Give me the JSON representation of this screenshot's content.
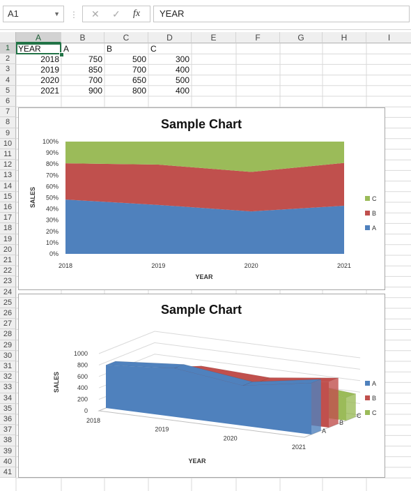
{
  "formula_bar": {
    "name_box": "A1",
    "cancel_icon": "✕",
    "enter_icon": "✓",
    "fx_icon": "fx",
    "formula_value": "YEAR"
  },
  "columns": [
    "A",
    "B",
    "C",
    "D",
    "E",
    "F",
    "G",
    "H",
    "I"
  ],
  "rows": [
    "1",
    "2",
    "3",
    "4",
    "5",
    "6",
    "7",
    "8",
    "9",
    "10",
    "11",
    "12",
    "13",
    "14",
    "15",
    "16",
    "17",
    "18",
    "19",
    "20",
    "21",
    "22",
    "23",
    "24",
    "25",
    "26",
    "27",
    "28",
    "29",
    "30",
    "31",
    "32",
    "33",
    "34",
    "35",
    "36",
    "37",
    "38",
    "39",
    "40",
    "41"
  ],
  "sheet": {
    "headers": [
      "YEAR",
      "A",
      "B",
      "C"
    ],
    "data_rows": [
      [
        "2018",
        "750",
        "500",
        "300"
      ],
      [
        "2019",
        "850",
        "700",
        "400"
      ],
      [
        "2020",
        "700",
        "650",
        "500"
      ],
      [
        "2021",
        "900",
        "800",
        "400"
      ]
    ]
  },
  "chart_data": [
    {
      "type": "area",
      "subtype": "100% stacked",
      "title": "Sample Chart",
      "xlabel": "YEAR",
      "ylabel": "SALES",
      "x": [
        "2018",
        "2019",
        "2020",
        "2021"
      ],
      "y_ticks": [
        "0%",
        "10%",
        "20%",
        "30%",
        "40%",
        "50%",
        "60%",
        "70%",
        "80%",
        "90%",
        "100%"
      ],
      "ylim": [
        0,
        1
      ],
      "series": [
        {
          "name": "A",
          "values": [
            750,
            850,
            700,
            900
          ],
          "color": "#4f81bd"
        },
        {
          "name": "B",
          "values": [
            500,
            700,
            650,
            800
          ],
          "color": "#c0504d"
        },
        {
          "name": "C",
          "values": [
            300,
            400,
            500,
            400
          ],
          "color": "#9bbb59"
        }
      ],
      "legend": [
        "C",
        "B",
        "A"
      ],
      "legend_position": "right"
    },
    {
      "type": "area",
      "subtype": "3-D area",
      "title": "Sample Chart",
      "xlabel": "YEAR",
      "ylabel": "SALES",
      "x": [
        "2018",
        "2019",
        "2020",
        "2021"
      ],
      "y_ticks": [
        "0",
        "200",
        "400",
        "600",
        "800",
        "1000"
      ],
      "ylim": [
        0,
        1000
      ],
      "depth_labels": [
        "A",
        "B",
        "C"
      ],
      "series": [
        {
          "name": "A",
          "values": [
            750,
            850,
            700,
            900
          ],
          "color": "#4f81bd"
        },
        {
          "name": "B",
          "values": [
            500,
            700,
            650,
            800
          ],
          "color": "#c0504d"
        },
        {
          "name": "C",
          "values": [
            300,
            400,
            500,
            400
          ],
          "color": "#9bbb59"
        }
      ],
      "legend": [
        "A",
        "B",
        "C"
      ],
      "legend_position": "right"
    }
  ]
}
